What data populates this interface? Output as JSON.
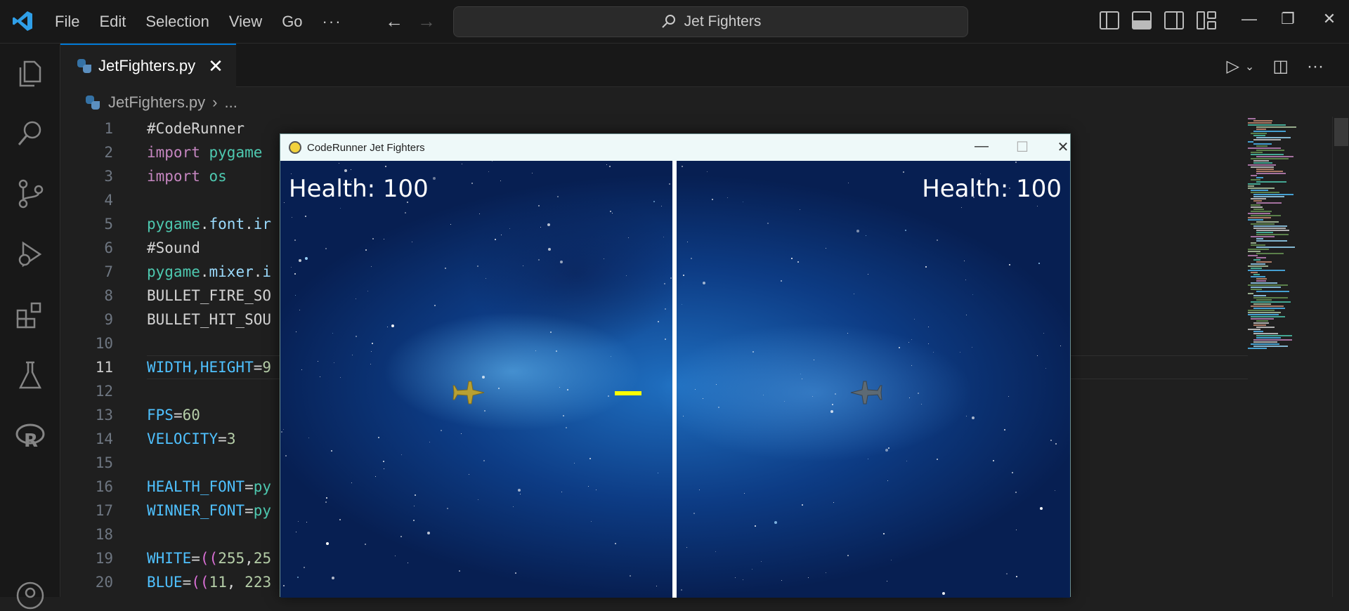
{
  "titlebar": {
    "menu": [
      "File",
      "Edit",
      "Selection",
      "View",
      "Go",
      "···"
    ],
    "search_text": "Jet Fighters"
  },
  "tab": {
    "filename": "JetFighters.py",
    "close": "✕"
  },
  "breadcrumb": {
    "file": "JetFighters.py",
    "sep": "›",
    "more": "..."
  },
  "editor": {
    "active_line": 11,
    "lines": [
      {
        "n": "1",
        "code": "#CodeRunner"
      },
      {
        "n": "2",
        "code": "import pygame"
      },
      {
        "n": "3",
        "code": "import os"
      },
      {
        "n": "4",
        "code": ""
      },
      {
        "n": "5",
        "code": "pygame.font.ir"
      },
      {
        "n": "6",
        "code": "#Sound"
      },
      {
        "n": "7",
        "code": "pygame.mixer.i"
      },
      {
        "n": "8",
        "code": "BULLET_FIRE_SO"
      },
      {
        "n": "9",
        "code": "BULLET_HIT_SOU"
      },
      {
        "n": "10",
        "code": ""
      },
      {
        "n": "11",
        "code": "WIDTH,HEIGHT=9"
      },
      {
        "n": "12",
        "code": ""
      },
      {
        "n": "13",
        "code": "FPS=60"
      },
      {
        "n": "14",
        "code": "VELOCITY=3"
      },
      {
        "n": "15",
        "code": ""
      },
      {
        "n": "16",
        "code": "HEALTH_FONT=py"
      },
      {
        "n": "17",
        "code": "WINNER_FONT=py"
      },
      {
        "n": "18",
        "code": ""
      },
      {
        "n": "19",
        "code": "WHITE=((255,25"
      },
      {
        "n": "20",
        "code": "BLUE=((11, 223"
      }
    ]
  },
  "game_window": {
    "title": "CodeRunner Jet Fighters",
    "left_health": "Health: 100",
    "right_health": "Health: 100"
  },
  "colors": {
    "accent": "#0078d4",
    "bullet": "#ffff00"
  }
}
